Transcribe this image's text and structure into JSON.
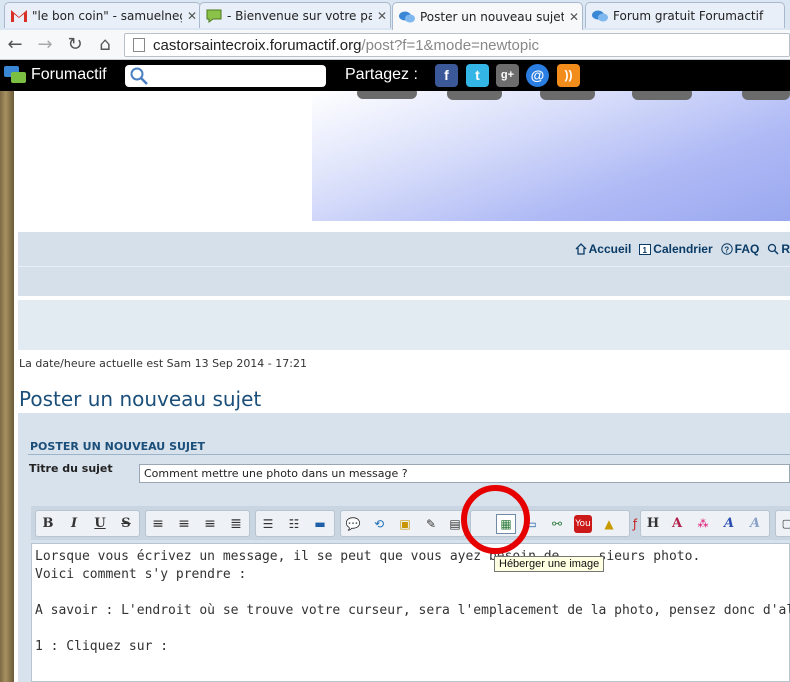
{
  "tabs": [
    {
      "title": "\"le bon coin\" - samuelneg",
      "icon": "gmail-icon"
    },
    {
      "title": "- Bienvenue sur votre pann",
      "icon": "chat-bubble-icon"
    },
    {
      "title": "Poster un nouveau sujet",
      "icon": "forum-icon",
      "active": true
    },
    {
      "title": "Forum gratuit Forumactif",
      "icon": "forum-icon"
    }
  ],
  "address": {
    "host": "castorsaintecroix.forumactif.org",
    "path": "/post?f=1&mode=newtopic"
  },
  "forumactif_bar": {
    "brand": "Forumactif",
    "search_value": "",
    "share_label": "Partagez :",
    "social": [
      "facebook",
      "twitter",
      "google-plus",
      "email",
      "rss"
    ]
  },
  "nav_links": [
    {
      "label": "Accueil",
      "icon": "home-icon"
    },
    {
      "label": "Calendrier",
      "icon": "calendar-icon"
    },
    {
      "label": "FAQ",
      "icon": "help-icon"
    },
    {
      "label": "R",
      "icon": "search-icon"
    }
  ],
  "datetime": "La date/heure actuelle est Sam 13 Sep 2014 - 17:21",
  "page_title": "Poster un nouveau sujet",
  "post_header": "POSTER UN NOUVEAU SUJET",
  "subject": {
    "label": "Titre du sujet",
    "value": "Comment mettre une photo dans un message ?"
  },
  "editor_lines": [
    "Lorsque vous écrivez un message, il se peut que vous ayez besoin de ... sieurs photo.",
    "Voici comment s'y prendre :",
    "",
    "A savoir : L'endroit où se trouve votre curseur, sera l'emplacement de la photo, pensez donc d'aller à la ligne avant",
    "",
    "1 : Cliquez sur  :"
  ],
  "tooltip": "Héberger une image",
  "colors": {
    "accent": "#1b4f7a",
    "highlight": "#e60000"
  }
}
